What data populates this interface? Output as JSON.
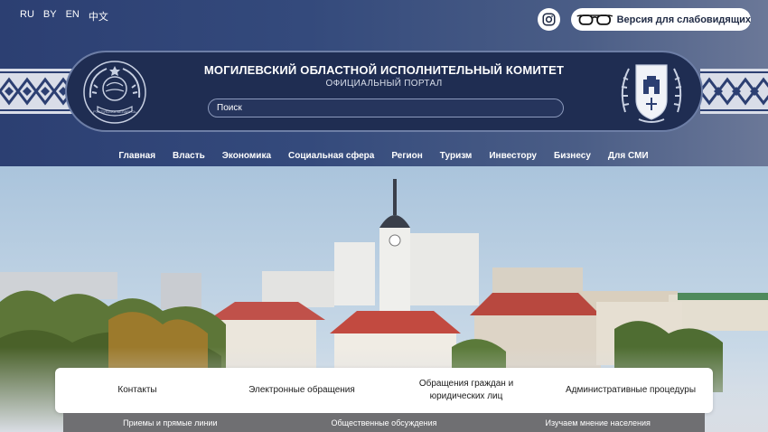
{
  "languages": [
    "RU",
    "BY",
    "EN",
    "中文"
  ],
  "accessibility_label": "Версия для слабовидящих",
  "banner": {
    "title": "МОГИЛЕВСКИЙ ОБЛАСТНОЙ ИСПОЛНИТЕЛЬНЫЙ КОМИТЕТ",
    "subtitle": "ОФИЦИАЛЬНЫЙ ПОРТАЛ",
    "search_placeholder": "Поиск",
    "left_emblem_text": "РЭСПУБЛІКА БЕЛАРУСЬ"
  },
  "nav": [
    "Главная",
    "Власть",
    "Экономика",
    "Социальная сфера",
    "Регион",
    "Туризм",
    "Инвестору",
    "Бизнесу",
    "Для СМИ"
  ],
  "quick_links": {
    "contacts": "Контакты",
    "e_appeals": "Электронные обращения",
    "appeals_line1": "Обращения граждан и",
    "appeals_line2": "юридических лиц",
    "admin_procedures": "Административные процедуры"
  },
  "sub_links": [
    "Приемы и прямые линии",
    "Общественные обсуждения",
    "Изучаем мнение населения"
  ],
  "colors": {
    "header_dark": "#2c3f72",
    "banner_bg": "#1f2d52",
    "subbar_bg": "#6f6f72"
  }
}
